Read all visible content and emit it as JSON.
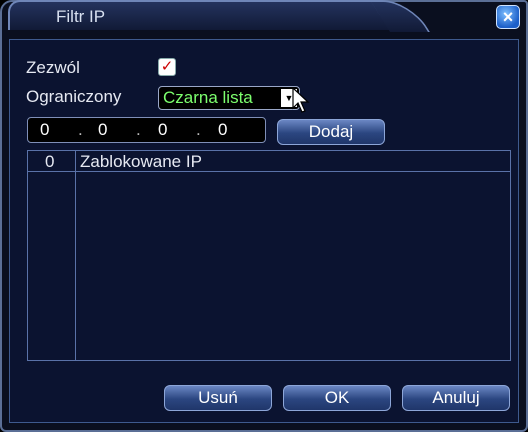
{
  "window": {
    "title": "Filtr IP",
    "close_label": "×"
  },
  "form": {
    "enable_label": "Zezwól",
    "enable_checked": true,
    "restrict_label": "Ograniczony",
    "restrict_value": "Czarna lista",
    "ip_segments": [
      "0",
      "0",
      "0",
      "0"
    ],
    "add_button": "Dodaj"
  },
  "list": {
    "columns": [
      "0",
      "Zablokowane IP"
    ]
  },
  "footer": {
    "delete_button": "Usuń",
    "ok_button": "OK",
    "cancel_button": "Anuluj"
  },
  "icons": {
    "checkbox": "checkmark-icon",
    "dropdown": "triangle-down-icon",
    "close": "close-icon",
    "cursor": "mouse-pointer-icon"
  }
}
